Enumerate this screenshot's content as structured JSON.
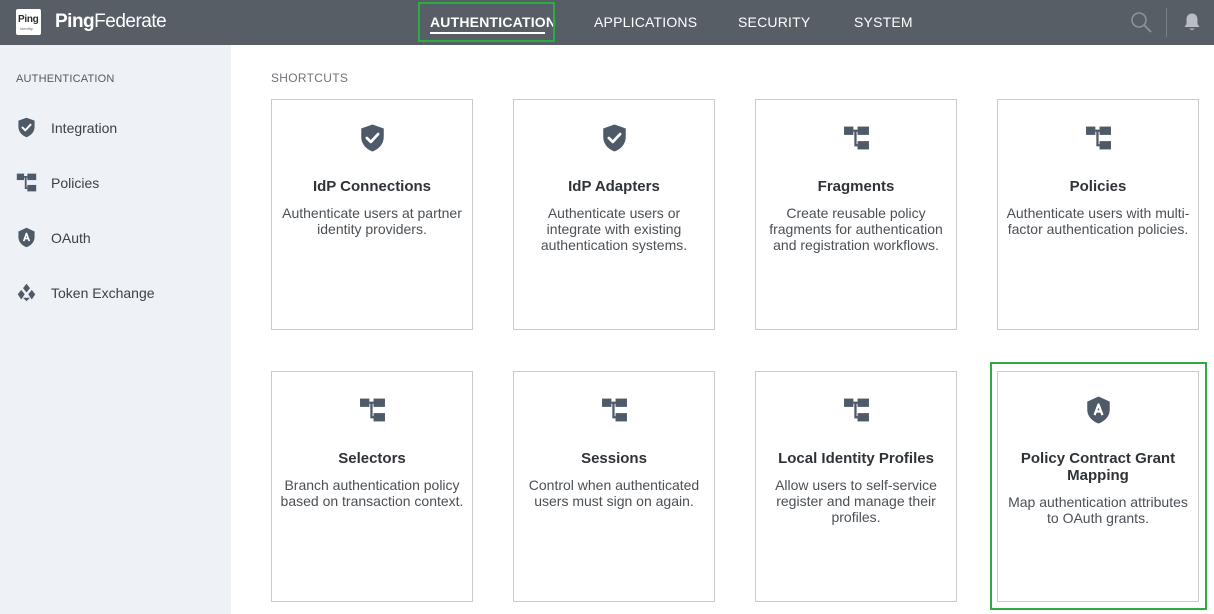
{
  "header": {
    "logo_badge": "Ping",
    "logo_badge_sub": "Identity",
    "logo_name_bold": "Ping",
    "logo_name_light": "Federate",
    "nav": [
      {
        "label": "AUTHENTICATION",
        "active": true
      },
      {
        "label": "APPLICATIONS",
        "active": false
      },
      {
        "label": "SECURITY",
        "active": false
      },
      {
        "label": "SYSTEM",
        "active": false
      }
    ],
    "icons": [
      "search-icon",
      "bell-icon"
    ]
  },
  "sidebar": {
    "title": "AUTHENTICATION",
    "items": [
      {
        "label": "Integration",
        "icon": "shield-check-icon"
      },
      {
        "label": "Policies",
        "icon": "policy-tree-icon"
      },
      {
        "label": "OAuth",
        "icon": "oauth-shield-icon"
      },
      {
        "label": "Token Exchange",
        "icon": "token-exchange-icon"
      }
    ]
  },
  "main": {
    "shortcuts_title": "SHORTCUTS",
    "cards": [
      {
        "title": "IdP Connections",
        "desc": "Authenticate users at partner identity providers.",
        "icon": "shield-check-icon"
      },
      {
        "title": "IdP Adapters",
        "desc": "Authenticate users or integrate with existing authentication systems.",
        "icon": "shield-check-icon"
      },
      {
        "title": "Fragments",
        "desc": "Create reusable policy fragments for authentication and registration workflows.",
        "icon": "policy-tree-icon"
      },
      {
        "title": "Policies",
        "desc": "Authenticate users with multi-factor authentication policies.",
        "icon": "policy-tree-icon"
      },
      {
        "title": "Selectors",
        "desc": "Branch authentication policy based on transaction context.",
        "icon": "policy-tree-icon"
      },
      {
        "title": "Sessions",
        "desc": "Control when authenticated users must sign on again.",
        "icon": "policy-tree-icon"
      },
      {
        "title": "Local Identity Profiles",
        "desc": "Allow users to self-service register and manage their profiles.",
        "icon": "policy-tree-icon"
      },
      {
        "title": "Policy Contract Grant Mapping",
        "desc": "Map authentication attributes to OAuth grants.",
        "icon": "oauth-shield-icon"
      }
    ]
  },
  "colors": {
    "header_bg": "#575e66",
    "sidebar_bg": "#eef2f6",
    "icon": "#4e5a68",
    "highlight": "#2eaa44"
  }
}
